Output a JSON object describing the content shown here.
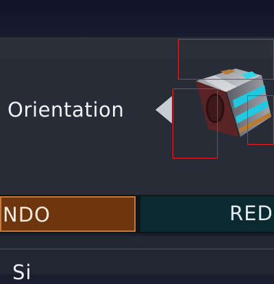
{
  "orientation": {
    "label": "Orientation",
    "prev_icon": "triangle-left-icon",
    "preview_icon": "cube-block-icon"
  },
  "mode_tabs": [
    {
      "label": "NDO",
      "active": true
    },
    {
      "label": "RED",
      "active": false
    }
  ],
  "bottom": {
    "label": "Si"
  },
  "colors": {
    "accent_active": "#6e360f",
    "accent_active_border": "#c9793b",
    "tab_inactive": "#0b2a2f",
    "panel": "#282c37",
    "highlight": "#e8202a",
    "cube_light": "#2fd6e8"
  }
}
